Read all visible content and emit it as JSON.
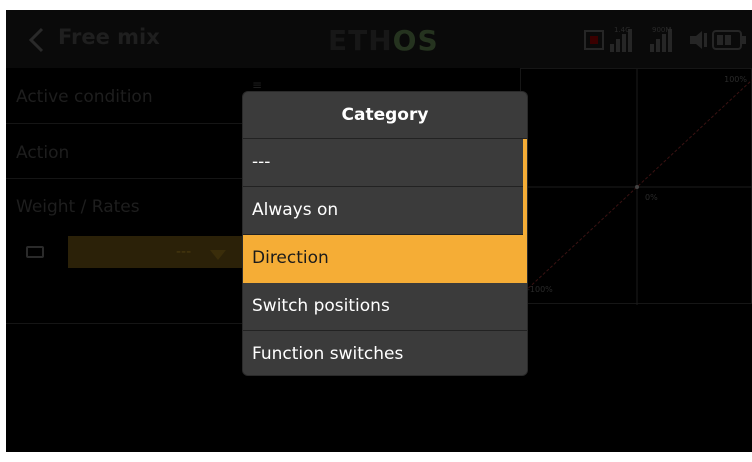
{
  "header": {
    "title": "Free mix",
    "logo_main": "ETH",
    "logo_accent": "OS",
    "signal_a": "1.4G",
    "signal_b": "900M"
  },
  "form": {
    "rows": [
      {
        "label": "Active condition"
      },
      {
        "label": "Action"
      },
      {
        "label": "Weight / Rates"
      }
    ],
    "weight_value": "---"
  },
  "graph": {
    "top_label": "100%",
    "center_label": "0%",
    "bottom_label": "-100%"
  },
  "modal": {
    "title": "Category",
    "options": [
      {
        "label": "---",
        "selected": false
      },
      {
        "label": "Always on",
        "selected": false
      },
      {
        "label": "Direction",
        "selected": true
      },
      {
        "label": "Switch positions",
        "selected": false
      },
      {
        "label": "Function switches",
        "selected": false
      }
    ]
  },
  "colors": {
    "accent": "#f5ad36",
    "modal_bg": "#3b3b3b",
    "screen_bg": "#000000"
  }
}
